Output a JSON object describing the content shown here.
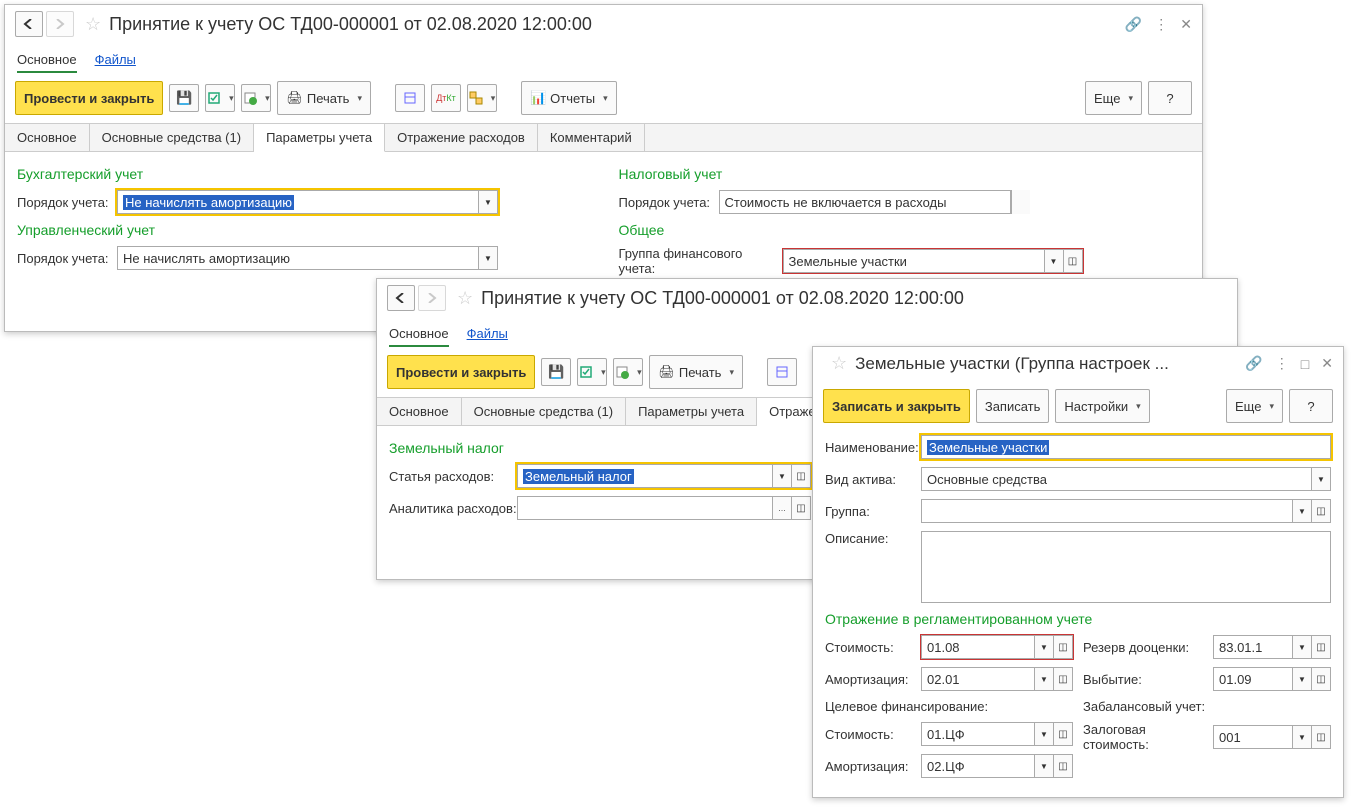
{
  "w1": {
    "title": "Принятие к учету ОС ТД00-000001 от 02.08.2020 12:00:00",
    "nav": {
      "main": "Основное",
      "files": "Файлы"
    },
    "toolbar": {
      "post_close": "Провести и закрыть",
      "print": "Печать",
      "reports": "Отчеты",
      "more": "Еще",
      "help": "?"
    },
    "tabs": {
      "main": "Основное",
      "assets": "Основные средства (1)",
      "params": "Параметры учета",
      "expenses": "Отражение расходов",
      "comment": "Комментарий"
    },
    "sec": {
      "acct": "Бухгалтерский учет",
      "tax": "Налоговый учет",
      "mgmt": "Управленческий учет",
      "common": "Общее"
    },
    "labels": {
      "order": "Порядок учета:",
      "fingroup": "Группа финансового учета:"
    },
    "values": {
      "acct_order": "Не начислять амортизацию",
      "tax_order": "Стоимость не включается в расходы",
      "mgmt_order": "Не начислять амортизацию",
      "fingroup": "Земельные участки"
    }
  },
  "w2": {
    "title": "Принятие к учету ОС ТД00-000001 от 02.08.2020 12:00:00",
    "nav": {
      "main": "Основное",
      "files": "Файлы"
    },
    "toolbar": {
      "post_close": "Провести и закрыть",
      "print": "Печать"
    },
    "tabs": {
      "main": "Основное",
      "assets": "Основные средства (1)",
      "params": "Параметры учета",
      "expenses": "Отражен"
    },
    "sec": {
      "land_tax": "Земельный налог"
    },
    "labels": {
      "article": "Статья расходов:",
      "analytics": "Аналитика расходов:"
    },
    "values": {
      "article": "Земельный налог",
      "analytics": ""
    }
  },
  "w3": {
    "title": "Земельные участки (Группа настроек ...",
    "toolbar": {
      "save_close": "Записать и закрыть",
      "save": "Записать",
      "settings": "Настройки",
      "more": "Еще",
      "help": "?"
    },
    "labels": {
      "name": "Наименование:",
      "asset_type": "Вид актива:",
      "group": "Группа:",
      "desc": "Описание:",
      "cost": "Стоимость:",
      "deprec": "Амортизация:",
      "target_fin": "Целевое финансирование:",
      "reserve": "Резерв дооценки:",
      "disposal": "Выбытие:",
      "offbalance": "Забалансовый учет:",
      "pledge": "Залоговая стоимость:"
    },
    "sec": {
      "reg": "Отражение в регламентированном учете"
    },
    "values": {
      "name": "Земельные участки",
      "asset_type": "Основные средства",
      "group": "",
      "desc": "",
      "cost": "01.08",
      "deprec": "02.01",
      "cost2": "01.ЦФ",
      "deprec2": "02.ЦФ",
      "reserve": "83.01.1",
      "disposal": "01.09",
      "pledge": "001"
    }
  }
}
